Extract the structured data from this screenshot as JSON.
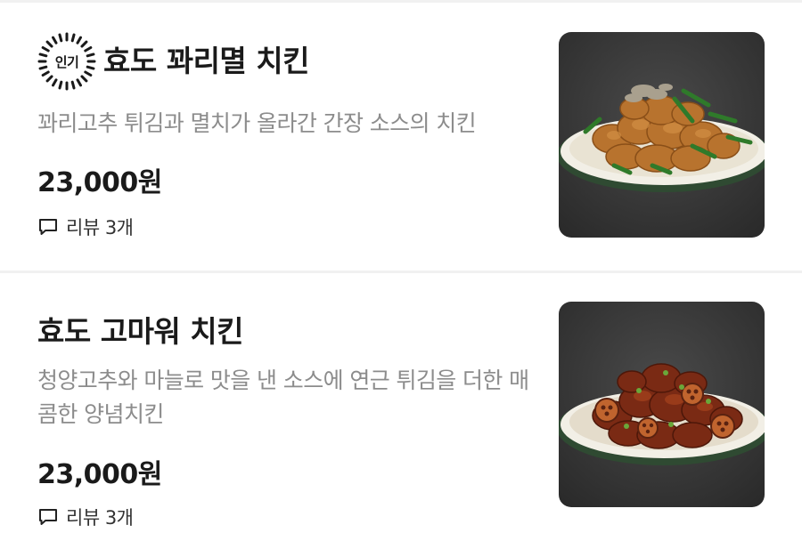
{
  "menu": {
    "items": [
      {
        "badge": "인기",
        "name": "효도 꽈리멸 치킨",
        "description": "꽈리고추 튀김과 멸치가 올라간 간장 소스의 치킨",
        "price": "23,000원",
        "reviews": "리뷰 3개",
        "image_icon": "fried-chicken-with-shishito-peppers-and-anchovies"
      },
      {
        "name": "효도 고마워 치킨",
        "description": "청양고추와 마늘로 맛을 낸 소스에 연근 튀김을 더한 매콤한 양념치킨",
        "price": "23,000원",
        "reviews": "리뷰 3개",
        "image_icon": "spicy-glazed-chicken-with-lotus-root"
      }
    ]
  },
  "colors": {
    "text_primary": "#1a1a1a",
    "text_secondary": "#8c8c8c",
    "divider": "#f1f1f1"
  }
}
